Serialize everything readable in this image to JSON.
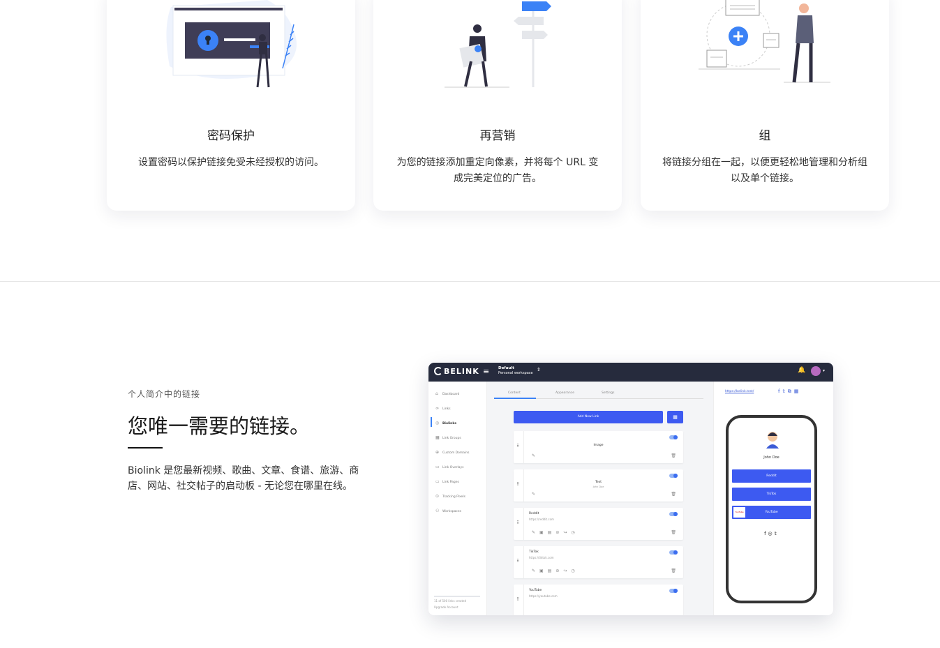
{
  "features": [
    {
      "title": "密码保护",
      "desc": "设置密码以保护链接免受未经授权的访问。"
    },
    {
      "title": "再营销",
      "desc": "为您的链接添加重定向像素，并将每个 URL 变成完美定位的广告。"
    },
    {
      "title": "组",
      "desc": "将链接分组在一起，以便更轻松地管理和分析组以及单个链接。"
    }
  ],
  "biolink": {
    "eyebrow": "个人简介中的链接",
    "heading": "您唯一需要的链接。",
    "paragraph": "Biolink 是您最新视频、歌曲、文章、食谱、旅游、商店、网站、社交帖子的启动板 - 无论您在哪里在线。"
  },
  "app": {
    "logo": "BELINK",
    "workspace": {
      "name": "Default",
      "sub": "Personal workspace"
    },
    "sidebar": [
      "Dashboard",
      "Links",
      "Biolinks",
      "Link Groups",
      "Custom Domains",
      "Link Overlays",
      "Link Pages",
      "Tracking Pixels",
      "Workspaces"
    ],
    "sidebar_footer": [
      "11 of 500 links created",
      "Upgrade Account"
    ],
    "tabs": [
      "Content",
      "Appearance",
      "Settings"
    ],
    "add_button": "Add New Link",
    "links": [
      {
        "title": "Image",
        "sub": ""
      },
      {
        "title": "Text",
        "sub": "John Doe"
      },
      {
        "title": "Reddit",
        "sub": "https://reddit.com"
      },
      {
        "title": "TikTok",
        "sub": "https://tiktok.com"
      },
      {
        "title": "YouTube",
        "sub": "https://youtube.com"
      }
    ],
    "preview": {
      "url": "https://belink.test/",
      "name": "John Doe",
      "buttons": [
        "Reddit",
        "TikTok",
        "YouTube"
      ],
      "thumb_label": "YouTube"
    }
  },
  "colors": {
    "accent": "#3d5af1",
    "topbar": "#262b3d"
  }
}
